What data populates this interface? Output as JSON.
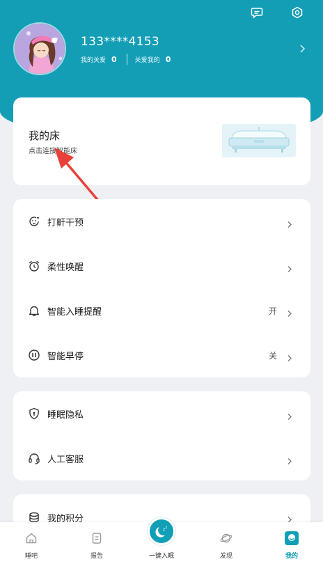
{
  "colors": {
    "primary": "#139eb6",
    "background": "#eef0f3",
    "arrow": "#e8413a"
  },
  "header": {
    "phone": "133****4153",
    "following_label": "我的关爱",
    "following_count": "0",
    "followers_label": "关爱我的",
    "followers_count": "0",
    "icons": [
      "chat-bubble-icon",
      "gear-icon"
    ]
  },
  "bed": {
    "title": "我的床",
    "subtitle": "点击连接智能床"
  },
  "group1": [
    {
      "label": "打鼾干预",
      "value": "",
      "icon": "snore-intervention-icon"
    },
    {
      "label": "柔性唤醒",
      "value": "",
      "icon": "alarm-clock-icon"
    },
    {
      "label": "智能入睡提醒",
      "value": "开",
      "icon": "bell-icon"
    },
    {
      "label": "智能早停",
      "value": "关",
      "icon": "pause-circle-icon"
    }
  ],
  "group2": [
    {
      "label": "睡眠隐私",
      "value": "",
      "icon": "shield-lock-icon"
    },
    {
      "label": "人工客服",
      "value": "",
      "icon": "headset-icon"
    }
  ],
  "group3": [
    {
      "label": "我的积分",
      "value": "",
      "icon": "coin-stack-icon"
    }
  ],
  "tabs": [
    {
      "label": "睡吧",
      "icon": "home-icon",
      "active": false
    },
    {
      "label": "报告",
      "icon": "report-icon",
      "active": false
    },
    {
      "label": "一键入眠",
      "icon": "moon-sleep-icon",
      "active": false
    },
    {
      "label": "发现",
      "icon": "planet-icon",
      "active": false
    },
    {
      "label": "我的",
      "icon": "profile-icon",
      "active": true
    }
  ]
}
